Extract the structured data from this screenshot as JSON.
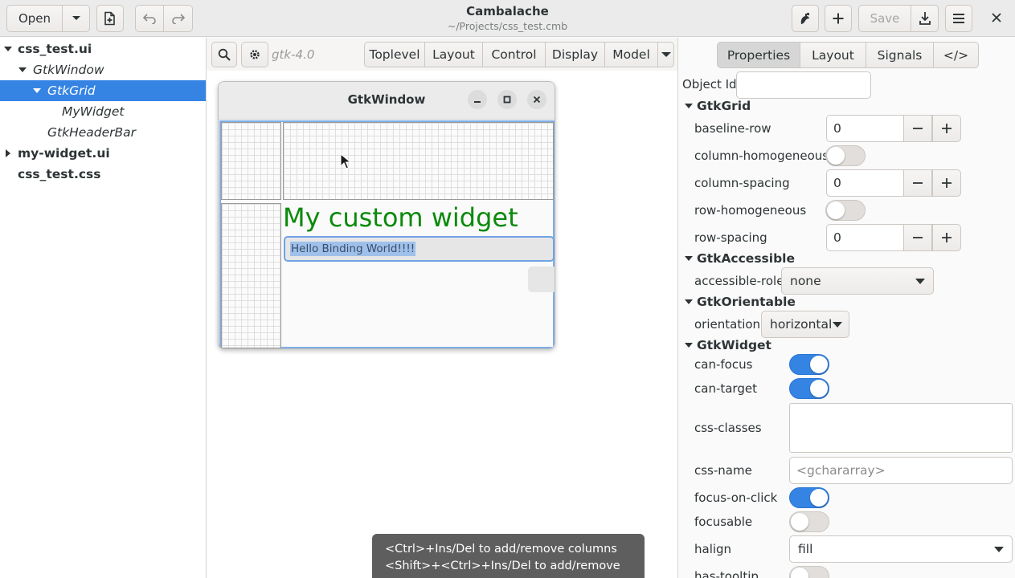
{
  "header": {
    "open_label": "Open",
    "save_label": "Save",
    "title": "Cambalache",
    "subtitle": "~/Projects/css_test.cmb",
    "icons": [
      "chevron-down-icon",
      "new-file-icon",
      "undo-icon",
      "redo-icon",
      "inspect-icon",
      "add-icon",
      "export-icon",
      "menu-icon",
      "close-icon"
    ]
  },
  "tree": {
    "items": [
      {
        "label": "css_test.ui",
        "style": "bold",
        "expanded": true
      },
      {
        "label": "GtkWindow",
        "style": "italic",
        "expanded": true
      },
      {
        "label": "GtkGrid",
        "style": "italic",
        "expanded": true,
        "selected": true
      },
      {
        "label": "MyWidget",
        "style": "italic"
      },
      {
        "label": "GtkHeaderBar",
        "style": "italic"
      },
      {
        "label": "my-widget.ui",
        "style": "bold",
        "expanded": false
      },
      {
        "label": "css_test.css",
        "style": "bold"
      }
    ]
  },
  "workspace": {
    "gtk_version": "gtk-4.0",
    "toolbar_buttons": [
      "Toplevel",
      "Layout",
      "Control",
      "Display",
      "Model"
    ],
    "preview": {
      "window_title": "GtkWindow",
      "custom_widget_text": "My custom widget",
      "entry_text": "Hello Binding World!!!!"
    },
    "tooltip": {
      "line1": "<Ctrl>+Ins/Del to add/remove columns",
      "line2": "<Shift>+<Ctrl>+Ins/Del to add/remove rows"
    }
  },
  "properties": {
    "tabs": [
      "Properties",
      "Layout",
      "Signals",
      "</>"
    ],
    "active_tab": "Properties",
    "object_id_label": "Object Id",
    "object_id_value": "",
    "sections": {
      "grid": {
        "title": "GtkGrid",
        "baseline_row_label": "baseline-row",
        "baseline_row_value": "0",
        "column_homogeneous_label": "column-homogeneous",
        "column_homogeneous": false,
        "column_spacing_label": "column-spacing",
        "column_spacing_value": "0",
        "row_homogeneous_label": "row-homogeneous",
        "row_homogeneous": false,
        "row_spacing_label": "row-spacing",
        "row_spacing_value": "0"
      },
      "accessible": {
        "title": "GtkAccessible",
        "accessible_role_label": "accessible-role",
        "accessible_role_value": "none"
      },
      "orientable": {
        "title": "GtkOrientable",
        "orientation_label": "orientation",
        "orientation_value": "horizontal"
      },
      "widget": {
        "title": "GtkWidget",
        "can_focus_label": "can-focus",
        "can_focus": true,
        "can_target_label": "can-target",
        "can_target": true,
        "css_classes_label": "css-classes",
        "css_name_label": "css-name",
        "css_name_placeholder": "<gchararray>",
        "focus_on_click_label": "focus-on-click",
        "focus_on_click": true,
        "focusable_label": "focusable",
        "focusable": false,
        "halign_label": "halign",
        "halign_value": "fill",
        "has_tooltip_label": "has-tooltip",
        "has_tooltip": false
      }
    }
  },
  "colors": {
    "accent": "#3584e4",
    "custom_widget_text": "#0b8a0b"
  }
}
